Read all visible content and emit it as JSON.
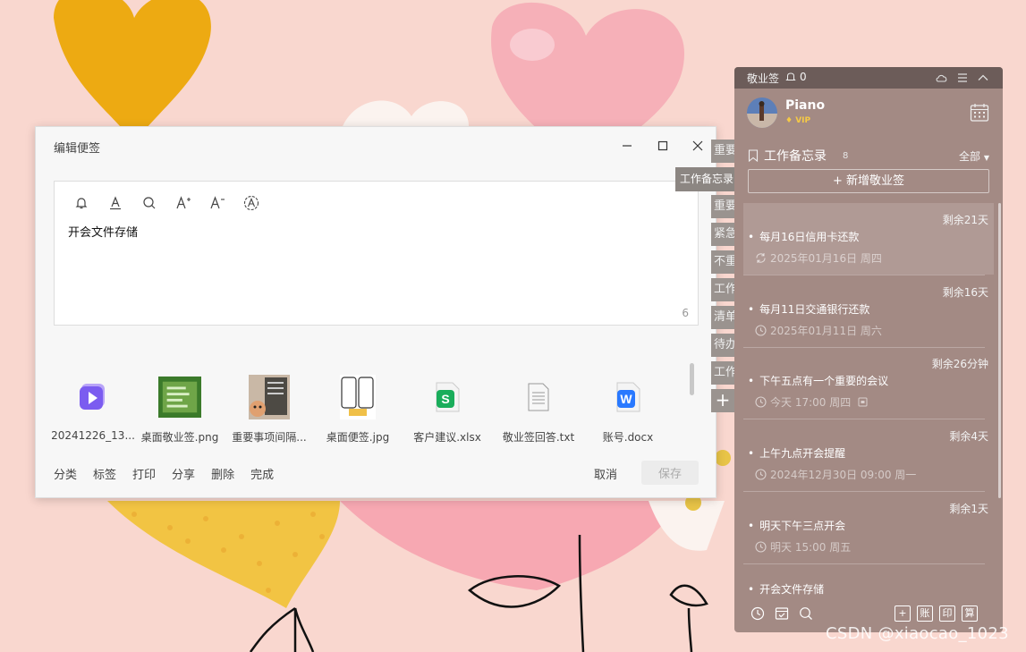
{
  "editor": {
    "title": "编辑便签",
    "note_text": "开会文件存储",
    "char_count": "6",
    "attachments": [
      {
        "name": "20241226_13...",
        "icon": "video-file-icon"
      },
      {
        "name": "桌面敬业签.png",
        "icon": "image-thumbnail"
      },
      {
        "name": "重要事项间隔...",
        "icon": "image-thumbnail"
      },
      {
        "name": "桌面便签.jpg",
        "icon": "image-thumbnail"
      },
      {
        "name": "客户建议.xlsx",
        "icon": "spreadsheet-file-icon"
      },
      {
        "name": "敬业签回答.txt",
        "icon": "text-file-icon"
      },
      {
        "name": "账号.docx",
        "icon": "word-file-icon"
      }
    ],
    "footer": {
      "categorize": "分类",
      "tag": "标签",
      "print": "打印",
      "share": "分享",
      "delete": "删除",
      "done": "完成",
      "cancel": "取消",
      "save": "保存"
    }
  },
  "categories": {
    "active": "工作备忘录",
    "tabs": [
      "重要",
      "重要",
      "紧急",
      "不重",
      "工作",
      "清单",
      "待办",
      "工作"
    ],
    "add": "+"
  },
  "panel": {
    "app_name": "敬业签",
    "notif_count": "0",
    "user": {
      "name": "Piano",
      "badge": "VIP"
    },
    "section": {
      "title": "工作备忘录",
      "count": "8",
      "filter": "全部"
    },
    "new_note": "+ 新增敬业签",
    "notes": [
      {
        "remain": "剩余21天",
        "title": "每月16日信用卡还款",
        "date": "2025年01月16日 周四"
      },
      {
        "remain": "剩余16天",
        "title": "每月11日交通银行还款",
        "date": "2025年01月11日 周六"
      },
      {
        "remain": "剩余26分钟",
        "title": "下午五点有一个重要的会议",
        "date": "今天 17:00 周四"
      },
      {
        "remain": "剩余4天",
        "title": "上午九点开会提醒",
        "date": "2024年12月30日 09:00 周一"
      },
      {
        "remain": "剩余1天",
        "title": "明天下午三点开会",
        "date": "明天 15:00 周五"
      },
      {
        "remain": "",
        "title": "开会文件存储",
        "date": ""
      }
    ],
    "bottom_buttons": [
      "账",
      "印",
      "算"
    ],
    "bottom_add": "+"
  },
  "watermark": "CSDN @xiaocao_1023"
}
